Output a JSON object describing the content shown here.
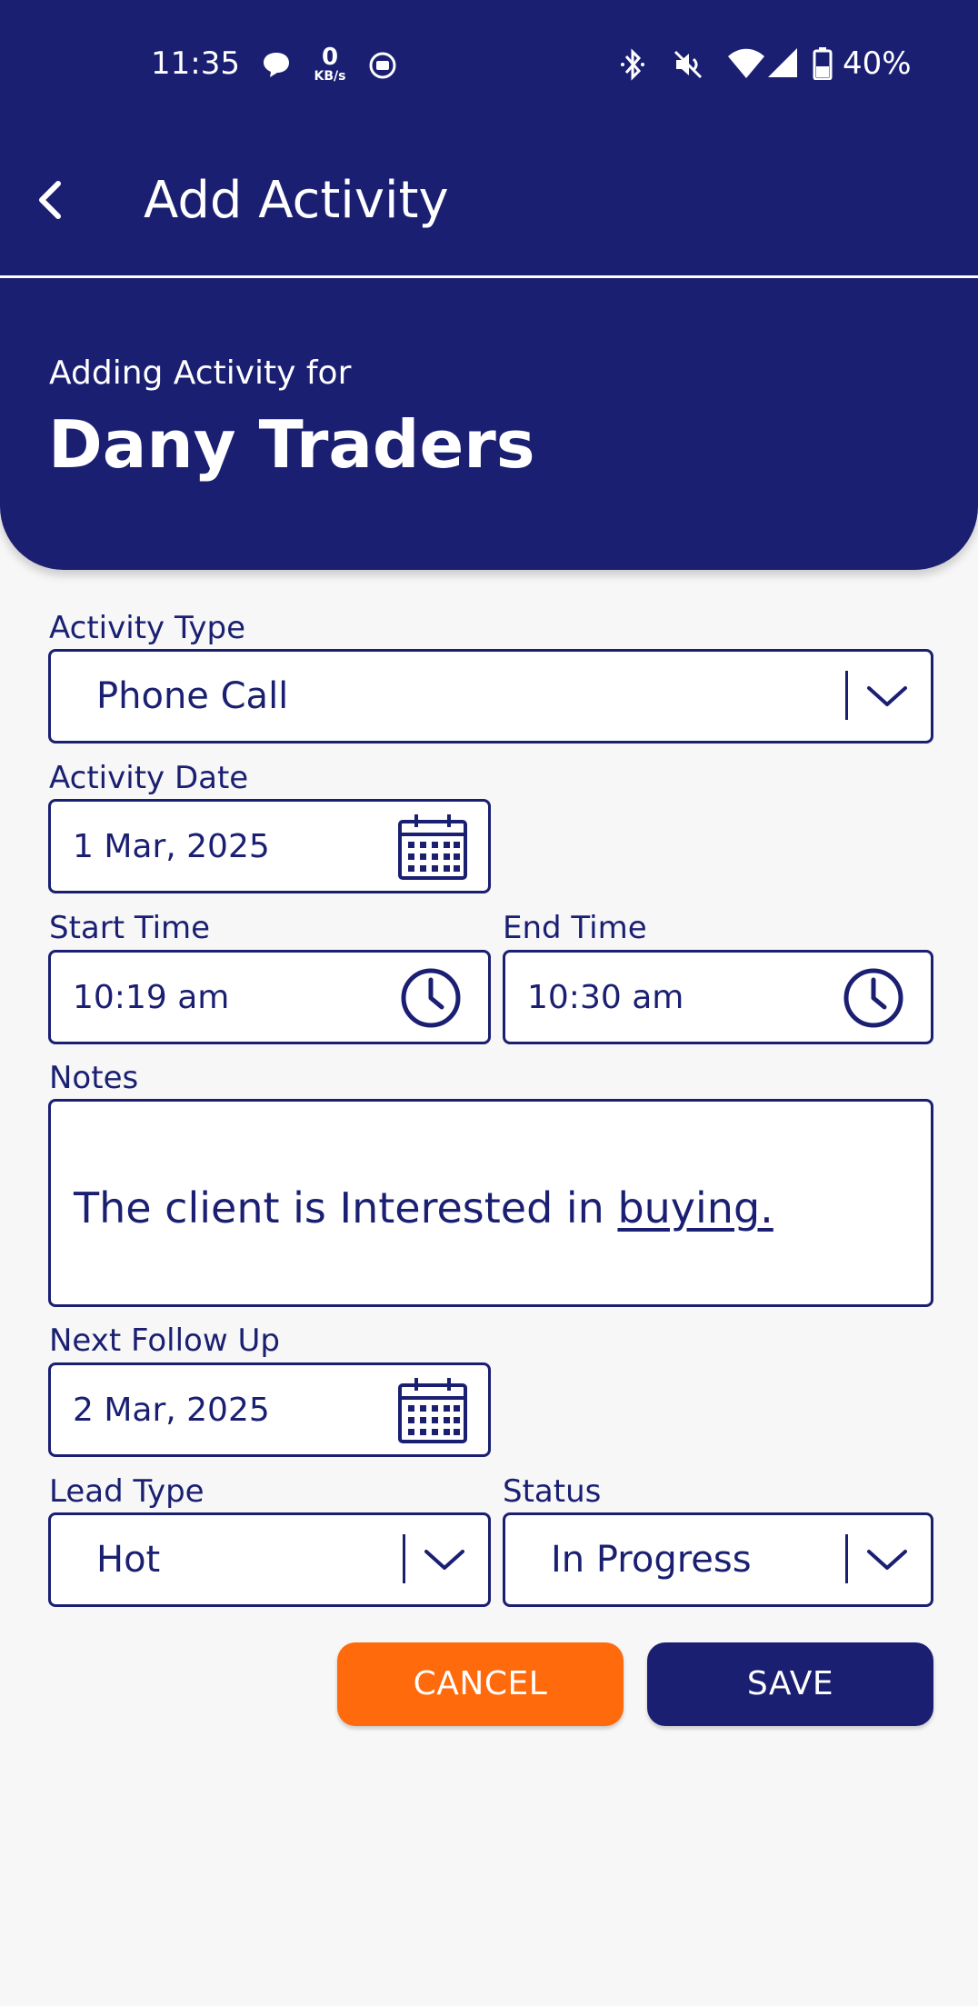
{
  "status_bar": {
    "time": "11:35",
    "net_speed_value": "0",
    "net_speed_unit": "KB/s",
    "battery": "40%",
    "icons": [
      "chat-bubble-icon",
      "kbs-indicator",
      "screen-record-icon",
      "bluetooth-icon",
      "mute-icon",
      "wifi-icon",
      "cell-signal-icon",
      "battery-icon"
    ]
  },
  "app_bar": {
    "title": "Add Activity",
    "back_icon": "back-arrow-icon"
  },
  "header": {
    "subtitle": "Adding Activity for",
    "company": "Dany Traders"
  },
  "form": {
    "activity_type": {
      "label": "Activity Type",
      "value": "Phone Call"
    },
    "activity_date": {
      "label": "Activity Date",
      "value": "1 Mar, 2025"
    },
    "start_time": {
      "label": "Start Time",
      "value": "10:19 am"
    },
    "end_time": {
      "label": "End Time",
      "value": "10:30 am"
    },
    "notes": {
      "label": "Notes",
      "value_plain": "The client is Interested in ",
      "value_underlined": "buying."
    },
    "next_follow_up": {
      "label": "Next Follow Up",
      "value": "2 Mar, 2025"
    },
    "lead_type": {
      "label": "Lead Type",
      "value": "Hot"
    },
    "status": {
      "label": "Status",
      "value": "In Progress"
    }
  },
  "actions": {
    "cancel_label": "CANCEL",
    "save_label": "SAVE"
  },
  "colors": {
    "primary": "#1a1f72",
    "accent": "#ff6a0c",
    "background": "#f7f7f7"
  }
}
